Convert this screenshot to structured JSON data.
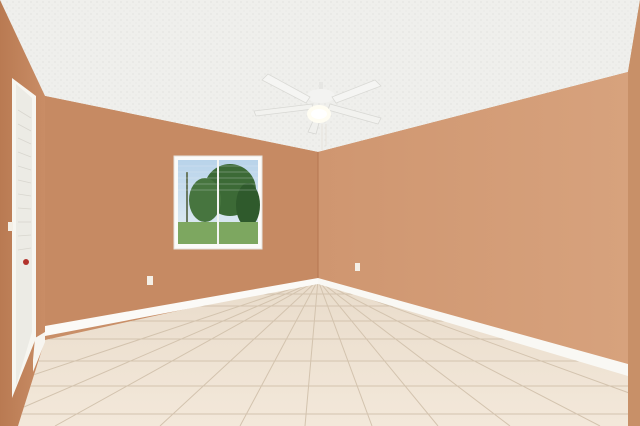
{
  "scene": {
    "subject": "empty-room-interior",
    "elements": [
      "textured-ceiling",
      "ceiling-fan",
      "back-wall",
      "left-wall",
      "right-wall",
      "window",
      "door",
      "tile-floor",
      "baseboards",
      "electrical-outlets"
    ]
  },
  "colors": {
    "ceiling": "#f1f1ee",
    "back_wall": "#c78c65",
    "left_wall": "#c1845c",
    "right_wall": "#d09a74",
    "floor": "#eee2d3",
    "grout": "#d6c7b4",
    "baseboard": "#fbfaf7",
    "fan": "#f5f5f3",
    "window_frame": "#fbfbf9",
    "foliage": "#3f6b3a",
    "sky": "#cfe2f0"
  }
}
